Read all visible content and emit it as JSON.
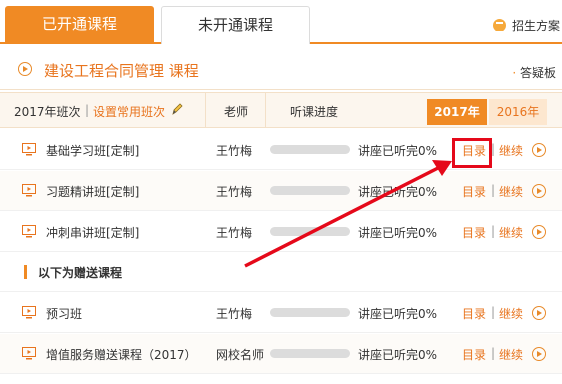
{
  "tabs": {
    "active": "已开通课程",
    "inactive": "未开通课程",
    "plan_link": "招生方案"
  },
  "course": {
    "title": "建设工程合同管理  课程",
    "qa_link": "答疑板"
  },
  "table_header": {
    "class_label": "2017年班次",
    "separator": "|",
    "set_common": "设置常用班次",
    "teacher": "老师",
    "progress": "听课进度",
    "year_active": "2017年",
    "year_inactive": "2016年"
  },
  "rows": [
    {
      "name": "基础学习班[定制]",
      "teacher": "王竹梅",
      "progress": 0,
      "status": "讲座已听完0%",
      "catalog": "目录",
      "sep": "|",
      "continue": "继续"
    },
    {
      "name": "习题精讲班[定制]",
      "teacher": "王竹梅",
      "progress": 0,
      "status": "讲座已听完0%",
      "catalog": "目录",
      "sep": "|",
      "continue": "继续"
    },
    {
      "name": "冲刺串讲班[定制]",
      "teacher": "王竹梅",
      "progress": 0,
      "status": "讲座已听完0%",
      "catalog": "目录",
      "sep": "|",
      "continue": "继续"
    }
  ],
  "gift_section": {
    "label": "以下为赠送课程"
  },
  "gift_rows": [
    {
      "name": "预习班",
      "teacher": "王竹梅",
      "progress": 0,
      "status": "讲座已听完0%",
      "catalog": "目录",
      "sep": "|",
      "continue": "继续"
    },
    {
      "name": "增值服务赠送课程（2017）",
      "teacher": "网校名师",
      "progress": 0,
      "status": "讲座已听完0%",
      "catalog": "目录",
      "sep": "|",
      "continue": "继续"
    }
  ],
  "colors": {
    "accent": "#f08a24",
    "accent_text": "#e8741e",
    "annotation_red": "#e5091a"
  },
  "icons": {
    "plan": "document-icon",
    "course": "play-circle-icon",
    "row": "screen-icon",
    "edit": "pencil-icon"
  }
}
